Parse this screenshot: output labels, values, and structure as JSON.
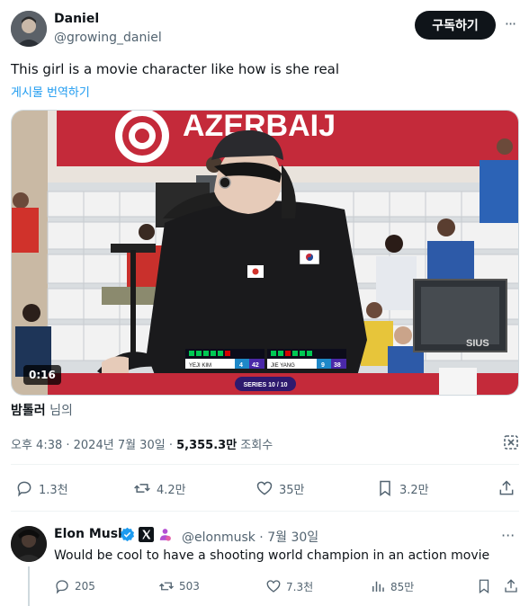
{
  "author": {
    "display_name": "Daniel",
    "handle": "@growing_daniel"
  },
  "subscribe_label": "구독하기",
  "more_label": "···",
  "tweet": {
    "text": "This girl is a movie character like how is she real",
    "translate_label": "게시물 번역하기"
  },
  "media": {
    "duration": "0:16",
    "banner_text": "AZERBAIJ",
    "scoreboard": {
      "left_name": "YEJI KIM",
      "left_shots": "4",
      "left_score": "42",
      "right_name": "JIE YANG",
      "right_shots": "9",
      "right_score": "38",
      "series": "SERIES 10 / 10"
    },
    "monitor_text": "SIUS"
  },
  "tagged": {
    "name": "밤톨러",
    "suffix": "님의"
  },
  "meta": {
    "time": "오후 4:38 · 2024년 7월 30일 · ",
    "views": "5,355.3만",
    "views_label": " 조회수"
  },
  "actions": {
    "replies": "1.3천",
    "reposts": "4.2만",
    "likes": "35만",
    "bookmarks": "3.2만"
  },
  "reply": {
    "display_name": "Elon Musk",
    "handle": "@elonmusk · 7월 30일",
    "text": "Would be cool to have a shooting world champion in an action movie",
    "replies": "205",
    "reposts": "503",
    "likes": "7.3천",
    "views": "85만",
    "more_label": "···"
  },
  "colors": {
    "link": "#1d9bf0",
    "text": "#0f1419",
    "secondary": "#536471",
    "verified": "#1d9bf0"
  }
}
